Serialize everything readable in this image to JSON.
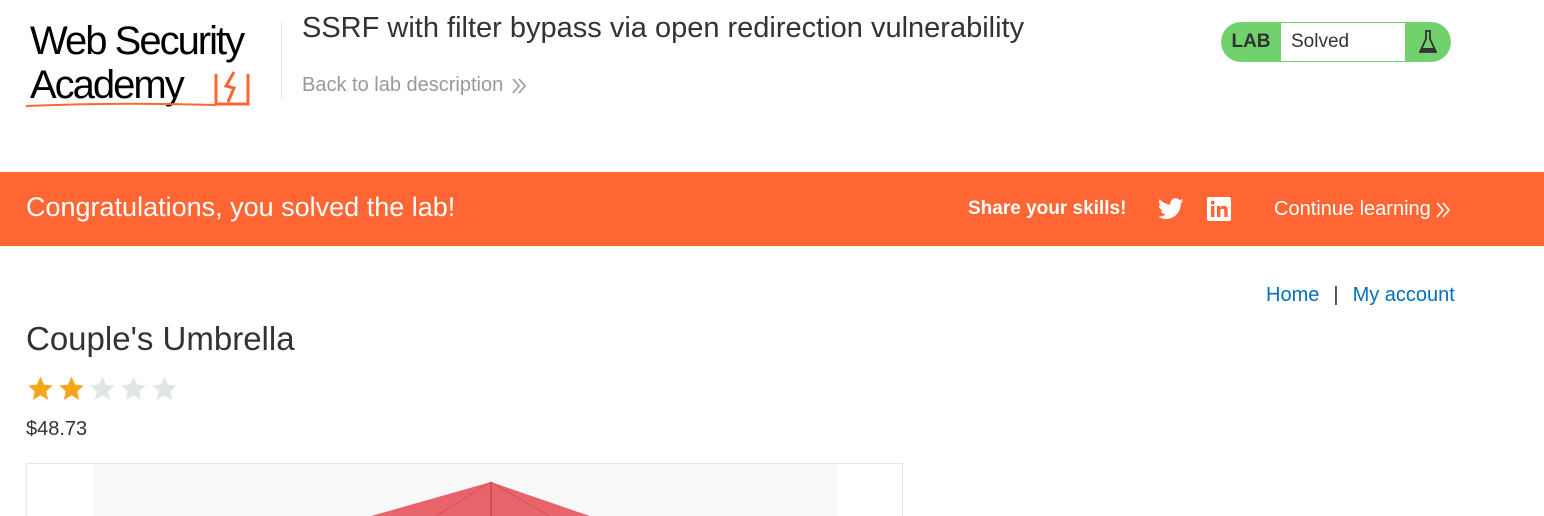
{
  "header": {
    "logo": {
      "line1": "Web Security",
      "line2": "Academy",
      "alt": "Web Security Academy"
    },
    "lab_title": "SSRF with filter bypass via open redirection vulnerability",
    "back_link": "Back to lab description",
    "badge": {
      "label": "LAB",
      "status": "Solved",
      "icon": "flask-icon"
    }
  },
  "banner": {
    "message": "Congratulations, you solved the lab!",
    "share_label": "Share your skills!",
    "twitter_icon": "twitter-icon",
    "linkedin_icon": "linkedin-icon",
    "continue_label": "Continue learning"
  },
  "nav": {
    "home": "Home",
    "separator": "|",
    "account": "My account"
  },
  "product": {
    "title": "Couple's Umbrella",
    "rating": 2,
    "rating_max": 5,
    "price": "$48.73"
  },
  "colors": {
    "brand_orange": "#ff6633",
    "badge_green": "#70d16d",
    "link_blue": "#0071bc",
    "star_filled": "#f8a51c",
    "star_empty": "#dfe6e6"
  }
}
